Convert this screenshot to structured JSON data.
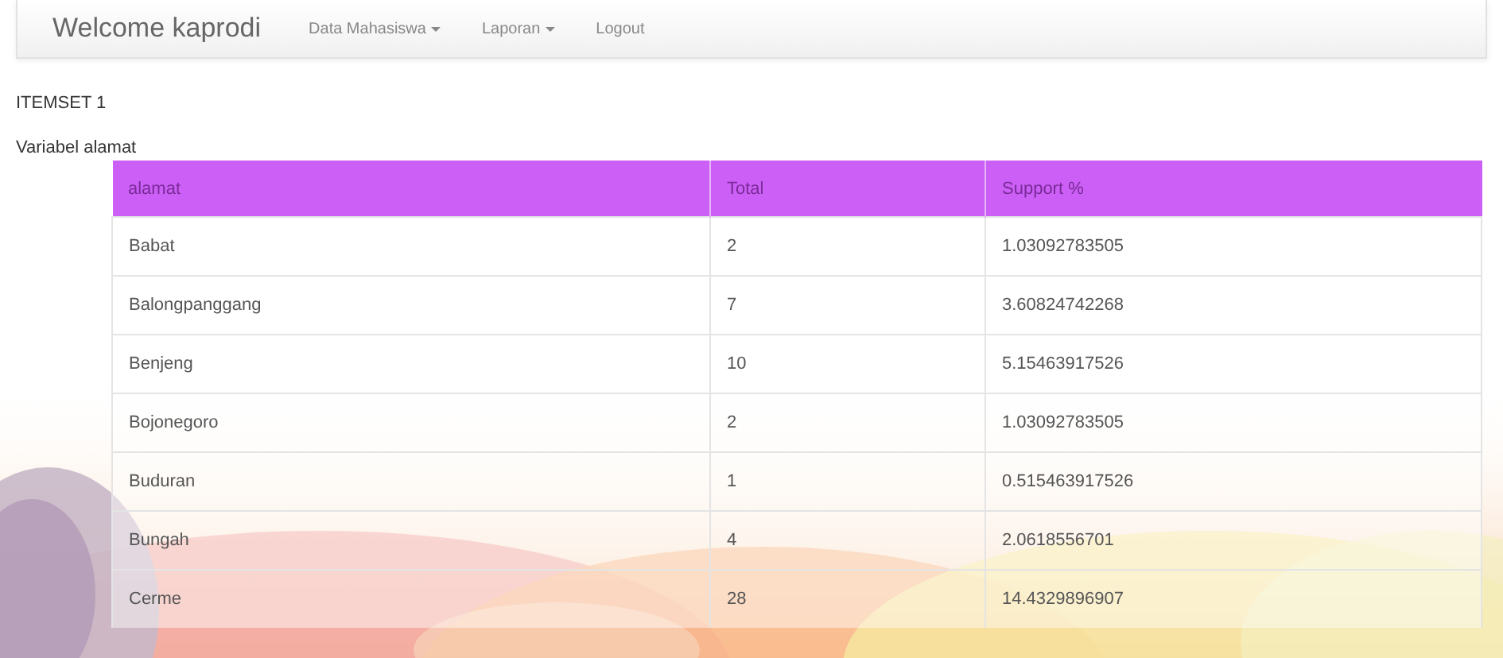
{
  "navbar": {
    "brand": "Welcome kaprodi",
    "items": [
      {
        "label": "Data Mahasiswa",
        "dropdown": true
      },
      {
        "label": "Laporan",
        "dropdown": true
      },
      {
        "label": "Logout",
        "dropdown": false
      }
    ]
  },
  "heading": "ITEMSET 1",
  "table_title": "Variabel alamat",
  "table": {
    "columns": [
      "alamat",
      "Total",
      "Support %"
    ],
    "rows": [
      [
        "Babat",
        "2",
        "1.03092783505"
      ],
      [
        "Balongpanggang",
        "7",
        "3.60824742268"
      ],
      [
        "Benjeng",
        "10",
        "5.15463917526"
      ],
      [
        "Bojonegoro",
        "2",
        "1.03092783505"
      ],
      [
        "Buduran",
        "1",
        "0.515463917526"
      ],
      [
        "Bungah",
        "4",
        "2.0618556701"
      ],
      [
        "Cerme",
        "28",
        "14.4329896907"
      ]
    ]
  }
}
